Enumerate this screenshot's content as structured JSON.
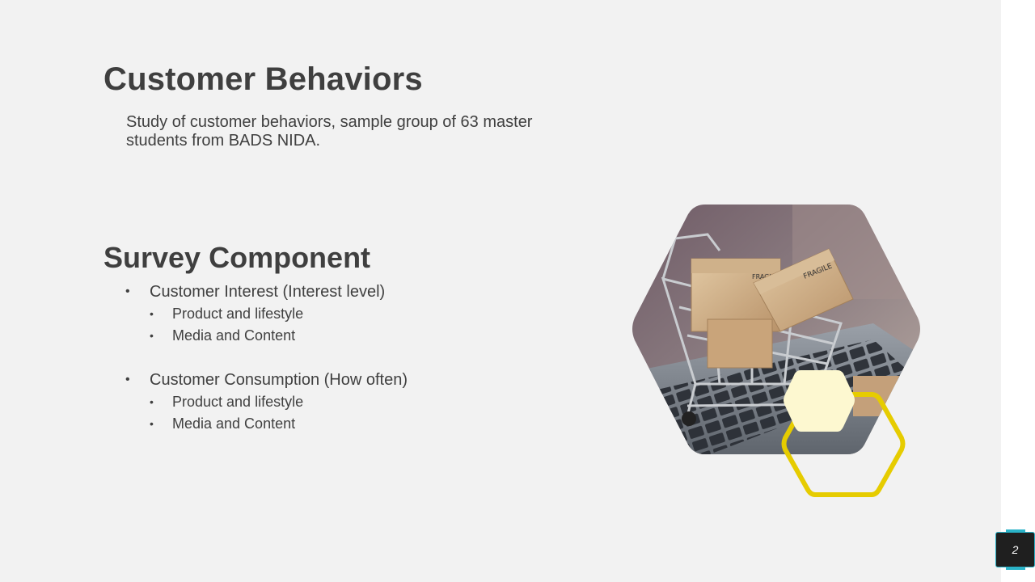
{
  "slide": {
    "title": "Customer Behaviors",
    "subtitle": "Study of customer behaviors, sample group of 63 master students from BADS NIDA.",
    "section_title": "Survey Component",
    "bullets": [
      {
        "label": "Customer Interest (Interest level)",
        "children": [
          "Product and lifestyle",
          "Media and Content"
        ]
      },
      {
        "label": "Customer Consumption  (How often)",
        "children": [
          "Product and lifestyle",
          "Media and Content"
        ]
      }
    ],
    "image": {
      "description_icon": "shopping-cart-with-boxes-on-laptop-photo"
    },
    "page_number": "2"
  },
  "colors": {
    "background": "#f2f2f2",
    "text": "#404040",
    "accent_yellow": "#e6cc00",
    "accent_cream": "#fdf8d0",
    "badge_teal": "#2ab3c8"
  }
}
